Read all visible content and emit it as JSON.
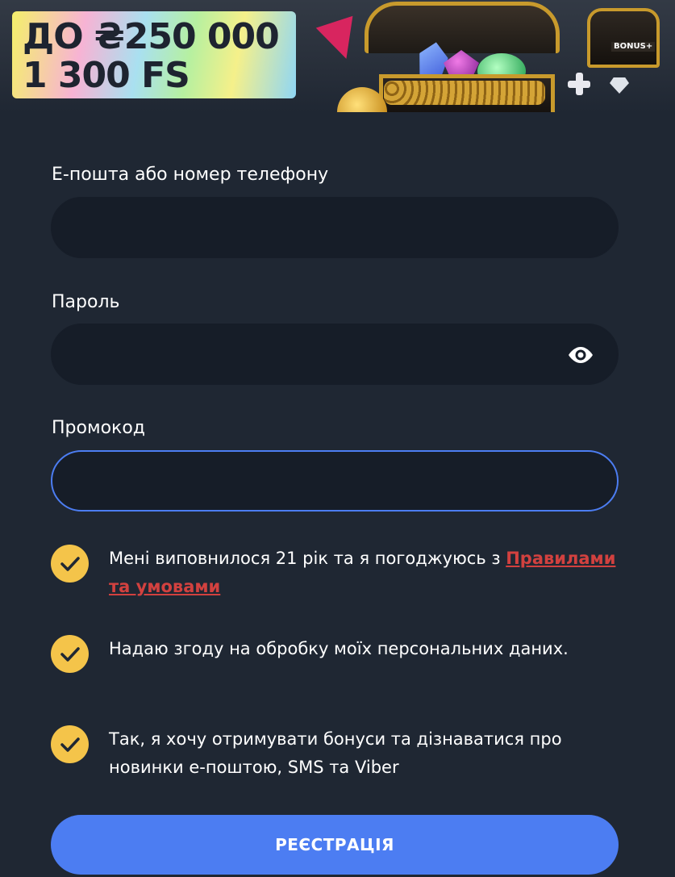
{
  "banner": {
    "amount_line": "ДО ₴250 000",
    "spins_line": "1 300 FS",
    "mini_chest_label": "BONUS+"
  },
  "form": {
    "email_label": "Е-пошта або номер телефону",
    "email_value": "",
    "password_label": "Пароль",
    "password_value": "",
    "password_toggle_icon": "eye-icon",
    "promo_label": "Промокод",
    "promo_value": ""
  },
  "checkboxes": [
    {
      "text": "Мені виповнилося 21 рік та я погоджуюсь з ",
      "link": "Правилами та умовами",
      "checked": true
    },
    {
      "text": "Надаю згоду на обробку моїх персональних даних.",
      "checked": true
    },
    {
      "text": "Так, я хочу отримувати бонуси та дізнаватися про новинки е-поштою, SMS та Viber",
      "checked": true
    }
  ],
  "submit_label": "РЕЄСТРАЦІЯ",
  "colors": {
    "background": "#1f2733",
    "field": "#161d28",
    "accent": "#4c7df2",
    "check": "#f4c44a",
    "link": "#d2413f"
  }
}
